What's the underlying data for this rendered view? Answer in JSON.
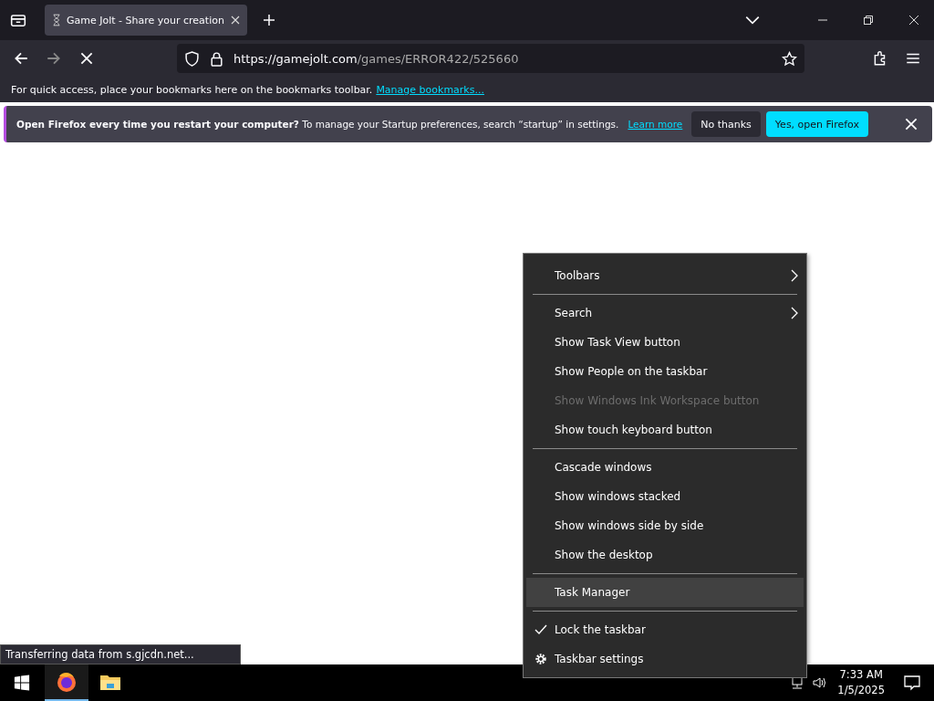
{
  "browser": {
    "tabs": [
      {
        "title": "Game Jolt - Share your creation",
        "selected": true,
        "loading": true
      }
    ],
    "url": {
      "host": "https://gamejolt.com",
      "path": "/games/ERROR422/525660"
    },
    "bookmarks_bar": {
      "text": "For quick access, place your bookmarks here on the bookmarks toolbar.",
      "link": "Manage bookmarks..."
    },
    "notification": {
      "title": "Open Firefox every time you restart your computer?",
      "text": "To manage your Startup preferences, search “startup” in settings.",
      "link": "Learn more",
      "buttons": [
        {
          "label": "No thanks",
          "kind": "secondary"
        },
        {
          "label": "Yes, open Firefox",
          "kind": "primary"
        }
      ]
    },
    "status": "Transferring data from s.gjcdn.net..."
  },
  "context_menu": {
    "items": [
      {
        "kind": "submenu",
        "label": "Toolbars",
        "disabled": false,
        "selected": false,
        "checked": false
      },
      {
        "kind": "separator"
      },
      {
        "kind": "submenu",
        "label": "Search",
        "disabled": false,
        "selected": false,
        "checked": false
      },
      {
        "kind": "item",
        "label": "Show Task View button",
        "disabled": false,
        "selected": false,
        "checked": false
      },
      {
        "kind": "item",
        "label": "Show People on the taskbar",
        "disabled": false,
        "selected": false,
        "checked": false
      },
      {
        "kind": "item",
        "label": "Show Windows Ink Workspace button",
        "disabled": true,
        "selected": false,
        "checked": false
      },
      {
        "kind": "item",
        "label": "Show touch keyboard button",
        "disabled": false,
        "selected": false,
        "checked": false
      },
      {
        "kind": "separator"
      },
      {
        "kind": "item",
        "label": "Cascade windows",
        "disabled": false,
        "selected": false,
        "checked": false
      },
      {
        "kind": "item",
        "label": "Show windows stacked",
        "disabled": false,
        "selected": false,
        "checked": false
      },
      {
        "kind": "item",
        "label": "Show windows side by side",
        "disabled": false,
        "selected": false,
        "checked": false
      },
      {
        "kind": "item",
        "label": "Show the desktop",
        "disabled": false,
        "selected": false,
        "checked": false
      },
      {
        "kind": "separator"
      },
      {
        "kind": "item",
        "label": "Task Manager",
        "disabled": false,
        "selected": true,
        "checked": false
      },
      {
        "kind": "separator"
      },
      {
        "kind": "item",
        "label": "Lock the taskbar",
        "disabled": false,
        "selected": false,
        "checked": true
      },
      {
        "kind": "settings",
        "label": "Taskbar settings",
        "disabled": false,
        "selected": false,
        "checked": false
      }
    ]
  },
  "taskbar": {
    "apps": [
      {
        "kind": "firefox",
        "selected": true
      },
      {
        "kind": "explorer",
        "selected": false
      }
    ],
    "clock": {
      "time": "7:33 AM",
      "date": "1/5/2025"
    }
  }
}
